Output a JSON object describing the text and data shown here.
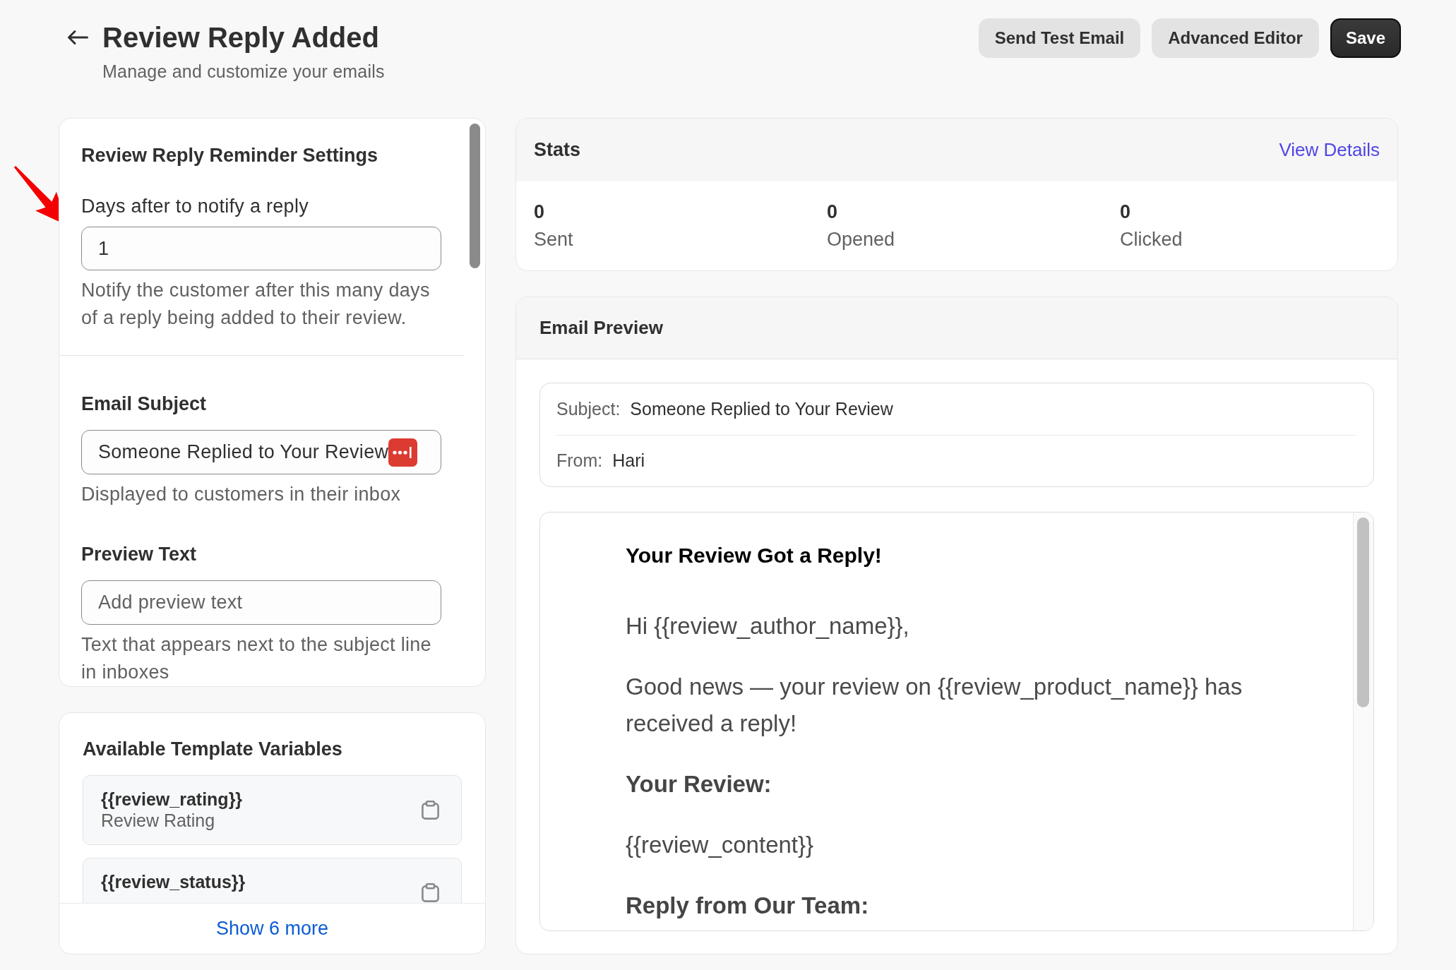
{
  "header": {
    "title": "Review Reply Added",
    "subtitle": "Manage and customize your emails",
    "buttons": [
      {
        "label": "Send Test Email",
        "kind": "secondary"
      },
      {
        "label": "Advanced Editor",
        "kind": "secondary"
      },
      {
        "label": "Save",
        "kind": "primary"
      }
    ]
  },
  "reminder_settings": {
    "title": "Review Reply Reminder Settings",
    "days_field": {
      "label": "Days after to notify a reply",
      "value": "1",
      "help": "Notify the customer after this many days of a reply being added to their review."
    },
    "email_subject": {
      "title": "Email Subject",
      "value": "Someone Replied to Your Review",
      "help": "Displayed to customers in their inbox"
    },
    "preview_text": {
      "title": "Preview Text",
      "placeholder": "Add preview text",
      "help": "Text that appears next to the subject line in inboxes"
    }
  },
  "template_variables": {
    "title": "Available Template Variables",
    "items": [
      {
        "name": "{{review_rating}}",
        "label": "Review Rating"
      },
      {
        "name": "{{review_status}}"
      }
    ],
    "show_more": "Show 6 more"
  },
  "stats": {
    "title": "Stats",
    "link": "View Details",
    "items": [
      {
        "value": "0",
        "label": "Sent"
      },
      {
        "value": "0",
        "label": "Opened"
      },
      {
        "value": "0",
        "label": "Clicked"
      }
    ]
  },
  "email_preview": {
    "title": "Email Preview",
    "subject_label": "Subject:",
    "subject": "Someone Replied to Your Review",
    "from_label": "From:",
    "from": "Hari",
    "body": [
      {
        "kind": "heading",
        "text": "Your Review Got a Reply!"
      },
      {
        "kind": "paragraph",
        "text": "Hi {{review_author_name}},"
      },
      {
        "kind": "paragraph",
        "text": "Good news — your review on {{review_product_name}} has received a reply!"
      },
      {
        "kind": "subheading",
        "text": "Your Review:"
      },
      {
        "kind": "paragraph",
        "text": "{{review_content}}"
      },
      {
        "kind": "subheading",
        "text": "Reply from Our Team:"
      }
    ]
  }
}
